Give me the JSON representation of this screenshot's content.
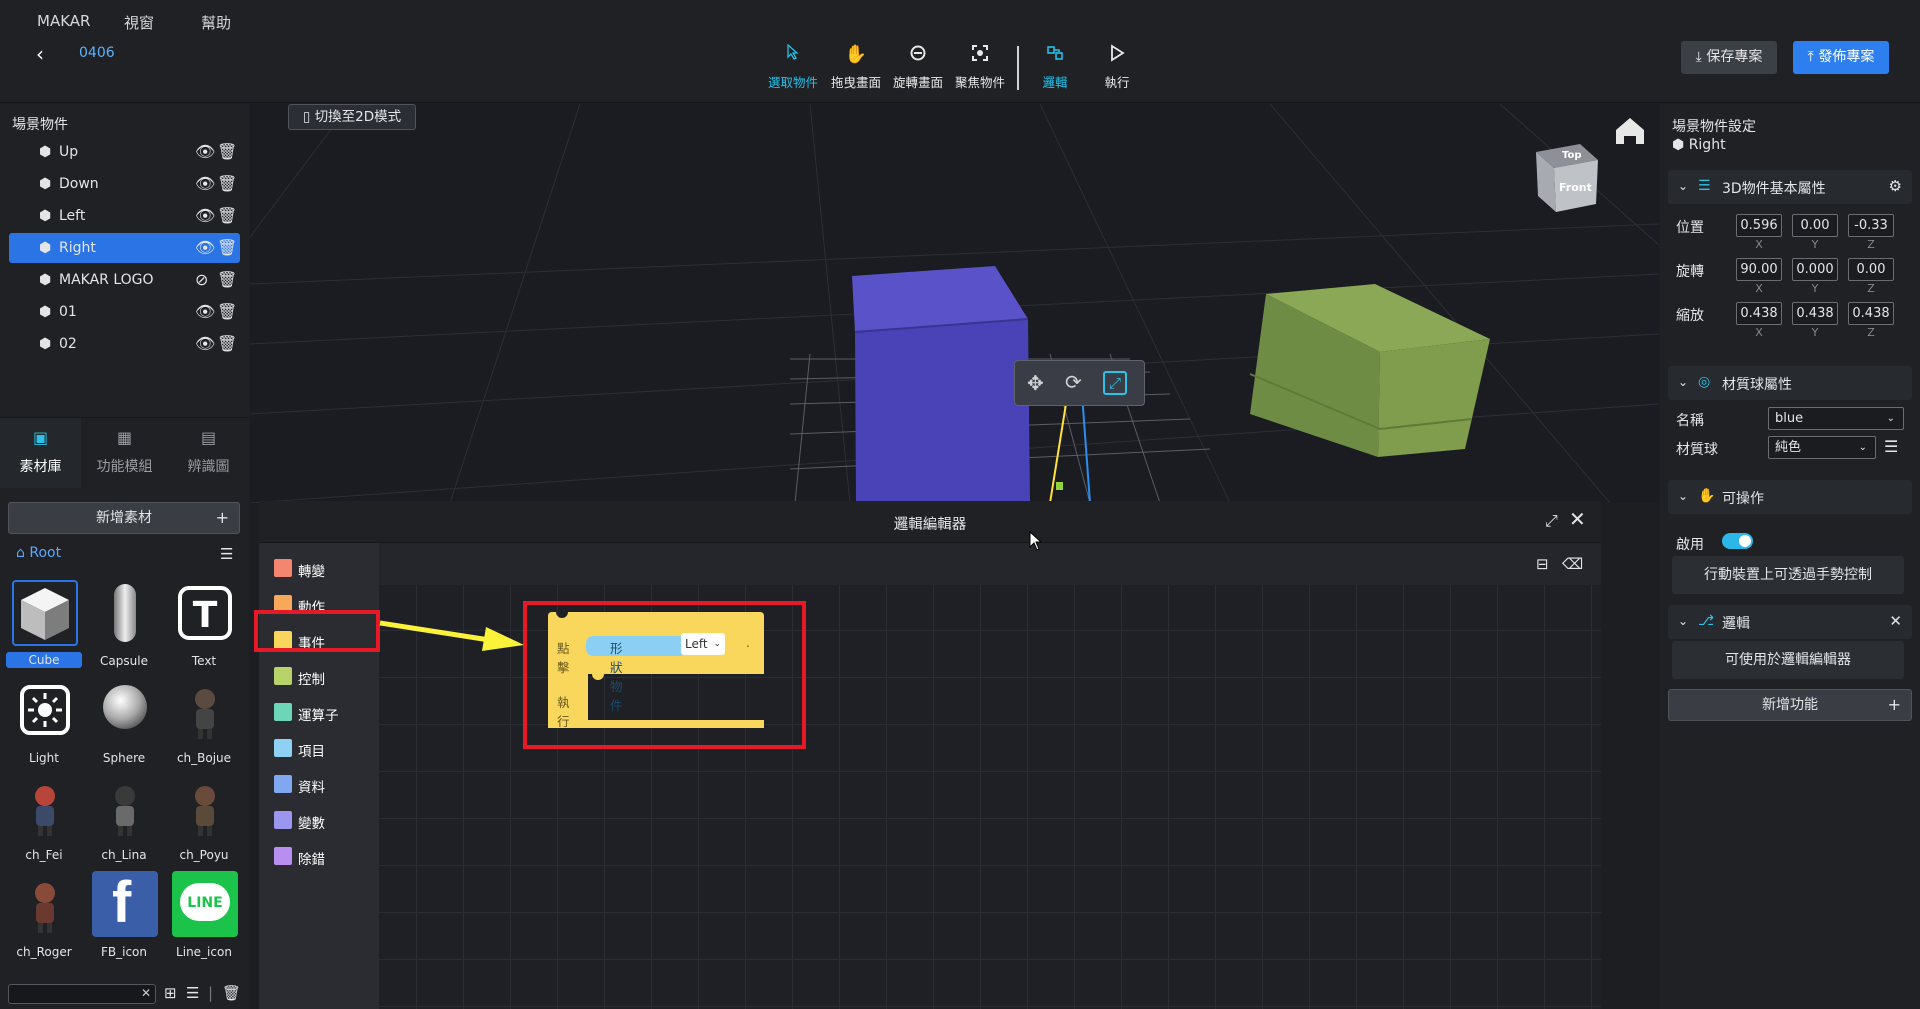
{
  "menu": [
    "MAKAR",
    "視窗",
    "幫助"
  ],
  "project_name": "0406",
  "tools": [
    {
      "label": "選取物件",
      "icon": "cursor-icon"
    },
    {
      "label": "拖曳畫面",
      "icon": "hand-icon"
    },
    {
      "label": "旋轉畫面",
      "icon": "rotate-view-icon"
    },
    {
      "label": "聚焦物件",
      "icon": "focus-icon"
    },
    {
      "label": "邏輯",
      "icon": "logic-icon"
    },
    {
      "label": "執行",
      "icon": "play-icon"
    }
  ],
  "save_label": "保存專案",
  "publish_label": "發佈專案",
  "scene": {
    "title": "場景物件",
    "objects": [
      "Up",
      "Down",
      "Left",
      "Right",
      "MAKAR LOGO",
      "01",
      "02"
    ],
    "selected": "Right"
  },
  "left_tabs": [
    "素材庫",
    "功能模組",
    "辨識圖"
  ],
  "add_asset_label": "新增素材",
  "root_label": "Root",
  "assets": [
    "Cube",
    "Capsule",
    "Text",
    "Light",
    "Sphere",
    "ch_Bojue",
    "ch_Fei",
    "ch_Lina",
    "ch_Poyu",
    "ch_Roger",
    "FB_icon",
    "Line_icon"
  ],
  "asset_badge": "T",
  "fb_glyph": "f",
  "line_glyph": "LINE",
  "switch_2d_label": "切換至2D模式",
  "gizmo_labels": {
    "top": "Top",
    "front": "Front"
  },
  "editor": {
    "title": "邏輯編輯器",
    "categories": [
      {
        "label": "轉變",
        "color": "#f4856f"
      },
      {
        "label": "動作",
        "color": "#f7a85a"
      },
      {
        "label": "事件",
        "color": "#f8d65c"
      },
      {
        "label": "控制",
        "color": "#b8d36a"
      },
      {
        "label": "運算子",
        "color": "#6ed6b8"
      },
      {
        "label": "項目",
        "color": "#8fd0f5"
      },
      {
        "label": "資料",
        "color": "#7fa8f0"
      },
      {
        "label": "變數",
        "color": "#9b96f0"
      },
      {
        "label": "除錯",
        "color": "#b88ef0"
      }
    ],
    "block": {
      "click": "點擊",
      "shape": "形狀物件",
      "value": "Left",
      "dot": ".",
      "exec": "執行"
    }
  },
  "right": {
    "title": "場景物件設定",
    "object": "Right",
    "basic_title": "3D物件基本屬性",
    "position_label": "位置",
    "position": [
      "0.596",
      "0.00",
      "-0.33"
    ],
    "rotation_label": "旋轉",
    "rotation": [
      "90.00",
      "0.000",
      "0.00"
    ],
    "scale_label": "縮放",
    "scale": [
      "0.438",
      "0.438",
      "0.438"
    ],
    "axes": [
      "X",
      "Y",
      "Z"
    ],
    "material_title": "材質球屬性",
    "name_label": "名稱",
    "name_value": "blue",
    "mat_label": "材質球",
    "mat_value": "純色",
    "operable_title": "可操作",
    "enable_label": "啟用",
    "operable_info": "行動裝置上可透過手勢控制",
    "logic_title": "邏輯",
    "logic_info": "可使用於邏輯編輯器",
    "add_func_label": "新增功能"
  }
}
